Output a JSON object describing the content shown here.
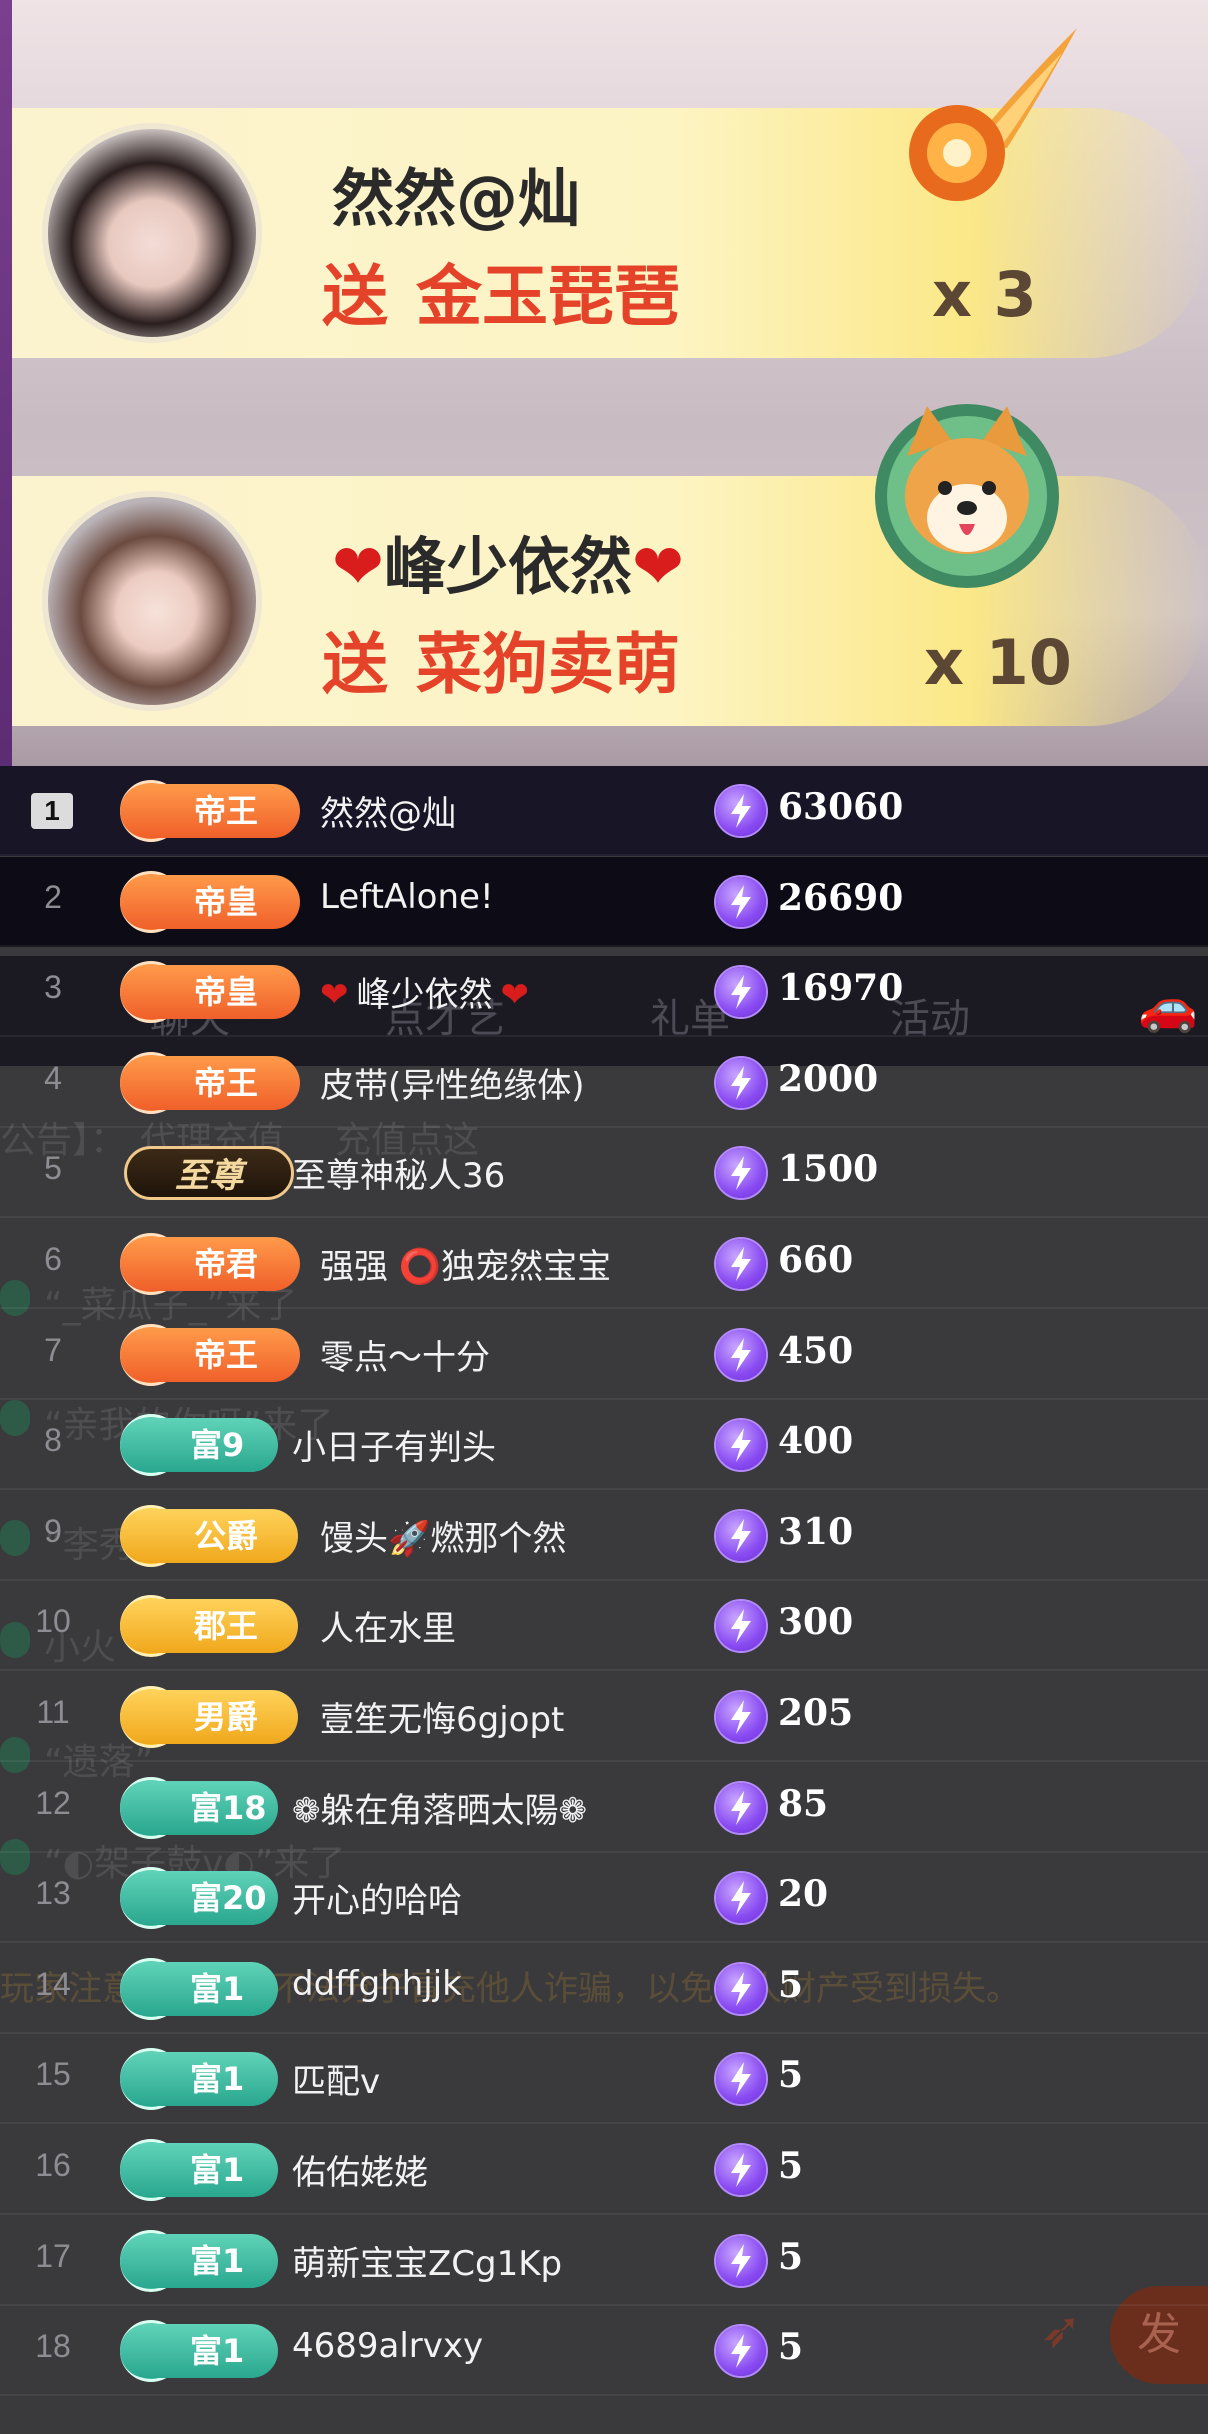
{
  "banners": [
    {
      "user": "然然@灿",
      "gift_verb": "送",
      "gift": "金玉琵琶",
      "count": "x 3",
      "gift_icon": "flaming-pipa-gift-icon"
    },
    {
      "user_prefix": "❤",
      "user": "峰少依然",
      "user_suffix": "❤",
      "gift_verb": "送",
      "gift": "菜狗卖萌",
      "count": "x 10",
      "gift_icon": "shiba-dog-gift-icon"
    }
  ],
  "background_chat": {
    "tabs": [
      "聊天",
      "点才艺",
      "礼单",
      "活动"
    ],
    "notice_prefix": "公告】：",
    "notice_buttons": [
      "代理充值",
      "充值点这"
    ],
    "warning": "玩家注意……谨防不法分子冒充他人诈骗，以免个人财产受到损失。",
    "lines": [
      "“_菜瓜子_”来了",
      "“亲我的你呀”来了",
      "“李秀”",
      "小火",
      "“遗落”",
      "“◐架子鼓v◐”来了"
    ],
    "send_button": "发"
  },
  "leaderboard": [
    {
      "rank": "1",
      "badge_type": "orange",
      "badge": "帝王",
      "name": "然然@灿",
      "score": "63060"
    },
    {
      "rank": "2",
      "badge_type": "orange",
      "badge": "帝皇",
      "name": "LeftAlone!",
      "score": "26690"
    },
    {
      "rank": "3",
      "badge_type": "orange",
      "badge": "帝皇",
      "name_prefix": "❤",
      "name": "峰少依然",
      "name_suffix": "❤",
      "score": "16970"
    },
    {
      "rank": "4",
      "badge_type": "orange",
      "badge": "帝王",
      "name": "皮带(异性绝缘体)",
      "score": "2000"
    },
    {
      "rank": "5",
      "badge_type": "zhizun",
      "badge": "至尊",
      "name": "至尊神秘人36",
      "score": "1500"
    },
    {
      "rank": "6",
      "badge_type": "orange",
      "badge": "帝君",
      "name": "强强 ⭕独宠然宝宝",
      "score": "660"
    },
    {
      "rank": "7",
      "badge_type": "orange",
      "badge": "帝王",
      "name": "零点～十分",
      "score": "450"
    },
    {
      "rank": "8",
      "badge_type": "teal",
      "badge": "富9",
      "name": "小日子有判头",
      "score": "400"
    },
    {
      "rank": "9",
      "badge_type": "gold",
      "badge": "公爵",
      "name": "馒头🚀燃那个然",
      "score": "310"
    },
    {
      "rank": "10",
      "badge_type": "gold",
      "badge": "郡王",
      "name": "人在水里",
      "score": "300"
    },
    {
      "rank": "11",
      "badge_type": "gold",
      "badge": "男爵",
      "name": "壹笙无悔6gjopt",
      "score": "205"
    },
    {
      "rank": "12",
      "badge_type": "teal",
      "badge": "富18",
      "name": "❁躲在角落晒太陽❁",
      "score": "85"
    },
    {
      "rank": "13",
      "badge_type": "teal",
      "badge": "富20",
      "name": "开心的哈哈",
      "score": "20"
    },
    {
      "rank": "14",
      "badge_type": "teal",
      "badge": "富1",
      "name": "ddffghhjjk",
      "score": "5"
    },
    {
      "rank": "15",
      "badge_type": "teal",
      "badge": "富1",
      "name": "匹配v",
      "score": "5"
    },
    {
      "rank": "16",
      "badge_type": "teal",
      "badge": "富1",
      "name": "佑佑姥姥",
      "score": "5"
    },
    {
      "rank": "17",
      "badge_type": "teal",
      "badge": "富1",
      "name": "萌新宝宝ZCg1Kp",
      "score": "5"
    },
    {
      "rank": "18",
      "badge_type": "teal",
      "badge": "富1",
      "name": "4689alrvxy",
      "score": "5"
    }
  ],
  "colors": {
    "accent_orange": "#f0602a",
    "gold": "#f0a81c",
    "teal": "#2aa78f",
    "coin_purple": "#8a4cf2",
    "gift_red": "#e4432a"
  }
}
